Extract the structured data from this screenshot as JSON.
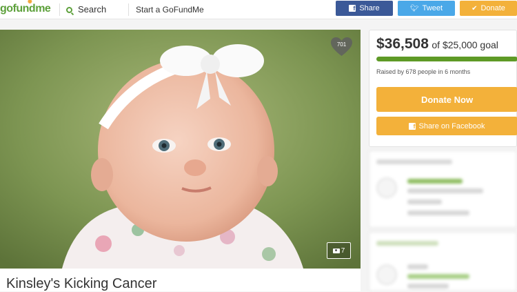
{
  "header": {
    "logo": "gofundme",
    "search_label": "Search",
    "start_link": "Start a GoFundMe",
    "share_label": "Share",
    "tweet_label": "Tweet",
    "donate_label": "Donate"
  },
  "hero": {
    "heart_count": "701",
    "photo_count": "7"
  },
  "campaign": {
    "title": "Kinsley's Kicking Cancer"
  },
  "donation": {
    "raised": "$36,508",
    "goal_text": "of $25,000 goal",
    "progress": 1.0,
    "raised_by": "Raised by 678 people in 6 months",
    "donate_now": "Donate Now",
    "share_facebook": "Share on Facebook"
  },
  "colors": {
    "brand_green": "#5da03b",
    "facebook": "#3b5998",
    "twitter": "#4aa8e8",
    "donate": "#f3b13a",
    "progress": "#5e9a26"
  }
}
